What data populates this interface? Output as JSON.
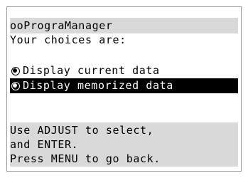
{
  "header": {
    "title": "ooPrograManager",
    "prompt": "Your choices are:"
  },
  "menu": {
    "options": [
      {
        "label": "Display current data",
        "selected": false
      },
      {
        "label": "Display memorized data",
        "selected": true
      }
    ]
  },
  "help": {
    "lines": [
      "Use ADJUST to select,",
      "and ENTER.",
      "Press MENU to go back."
    ]
  },
  "colors": {
    "band_gray": "#d9d9d9",
    "selected_bg": "#000000",
    "selected_text": "#ffffff"
  }
}
